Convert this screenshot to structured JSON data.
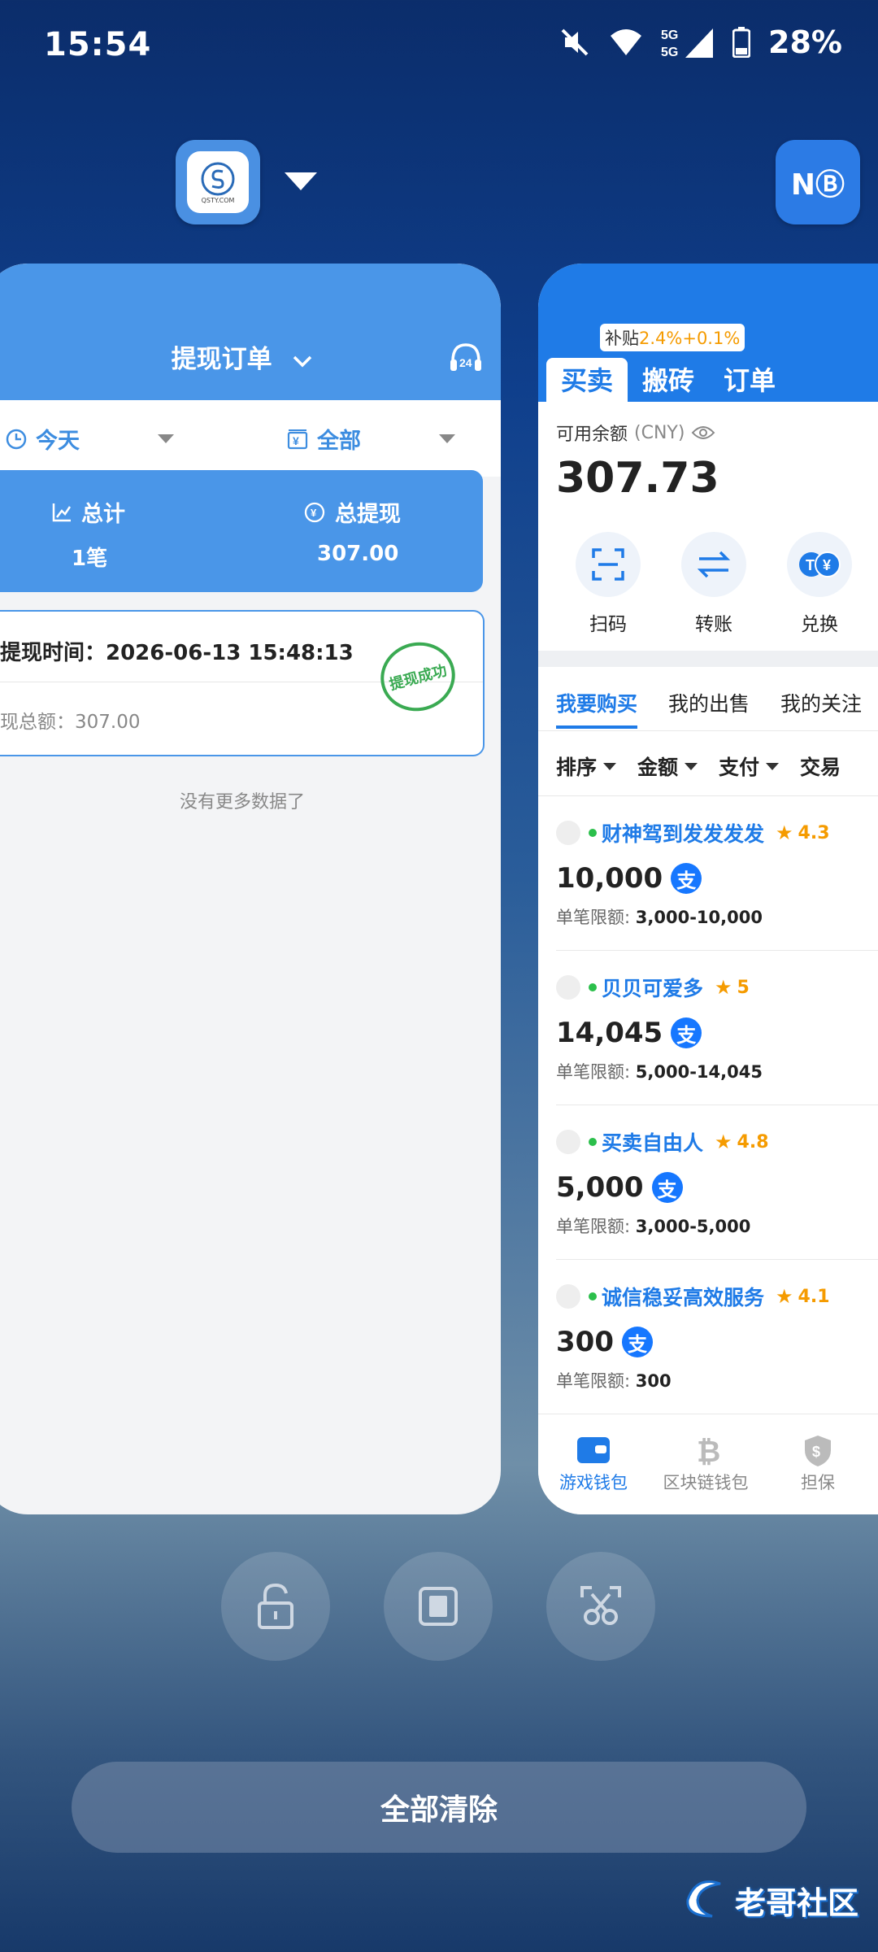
{
  "status_bar": {
    "time": "15:54",
    "battery": "28%",
    "network": "5G"
  },
  "recents": {
    "left_app_icon_text": "QSTY.COM",
    "right_app_icon_text": "NⒷ",
    "clear_all": "全部清除",
    "watermark": "老哥社区"
  },
  "left_card": {
    "title": "提现订单",
    "filter_date": "今天",
    "filter_type": "全部",
    "summary": {
      "total_label": "总计",
      "total_value": "1笔",
      "withdraw_label": "总提现",
      "withdraw_value": "307.00"
    },
    "record": {
      "time": "提现时间：2026-06-13 15:48:13",
      "amount": "现总额：307.00",
      "stamp": "提现成功"
    },
    "no_more": "没有更多数据了"
  },
  "right_card": {
    "subsidy_prefix": "补贴",
    "subsidy_value": "2.4%+0.1%",
    "tabs": [
      "买卖",
      "搬砖",
      "订单"
    ],
    "balance_label": "可用余额",
    "balance_currency": "(CNY)",
    "balance_value": "307.73",
    "quick_actions": [
      "扫码",
      "转账",
      "兑换"
    ],
    "sub_tabs": [
      "我要购买",
      "我的出售",
      "我的关注"
    ],
    "filters": [
      "排序",
      "金额",
      "支付",
      "交易"
    ],
    "limit_label": "单笔限额:",
    "offers": [
      {
        "name": "财神驾到发发发发",
        "rating": "4.3",
        "amount": "10,000",
        "limit": "3,000-10,000"
      },
      {
        "name": "贝贝可爱多",
        "rating": "5",
        "amount": "14,045",
        "limit": "5,000-14,045"
      },
      {
        "name": "买卖自由人",
        "rating": "4.8",
        "amount": "5,000",
        "limit": "3,000-5,000"
      },
      {
        "name": "诚信稳妥高效服务",
        "rating": "4.1",
        "amount": "300",
        "limit": "300"
      }
    ],
    "bottom_nav": [
      "游戏钱包",
      "区块链钱包",
      "担保"
    ]
  }
}
